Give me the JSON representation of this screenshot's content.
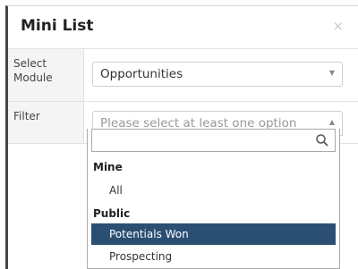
{
  "modal": {
    "title": "Mini List",
    "close_label": "×"
  },
  "module_field": {
    "label": "Select Module",
    "value": "Opportunities"
  },
  "filter_field": {
    "label": "Filter",
    "placeholder": "Please select at least one option"
  },
  "dropdown": {
    "search_value": "",
    "groups": [
      {
        "label": "Mine",
        "options": [
          {
            "label": "All",
            "selected": false
          }
        ]
      },
      {
        "label": "Public",
        "options": [
          {
            "label": "Potentials Won",
            "selected": true
          },
          {
            "label": "Prospecting",
            "selected": false
          }
        ]
      }
    ]
  },
  "colors": {
    "selected_bg": "#2b4f73",
    "left_bar": "#454545"
  }
}
